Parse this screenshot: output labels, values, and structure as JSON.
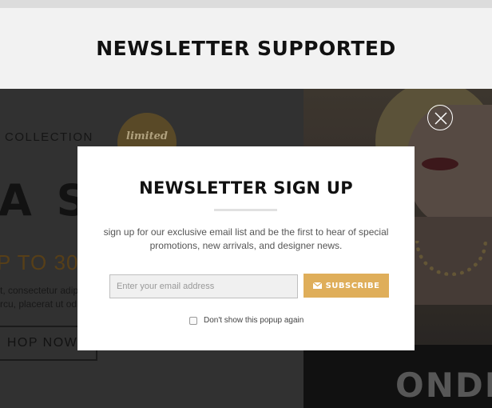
{
  "banner": {
    "title": "NEWSLETTER SUPPORTED"
  },
  "background_page": {
    "collection_text": "COLLECTION",
    "badge_text": "limited",
    "big_headline": "A S",
    "upto_text": "P TO 30",
    "body_line1": "t, consectetur adip",
    "body_line2": "rcu, placerat ut od",
    "shop_button": "HOP NOW!",
    "shirt_text": "ONDI"
  },
  "popup": {
    "title": "NEWSLETTER SIGN UP",
    "description": "sign up for our exclusive email list and be the first to hear of special promotions, new arrivals, and designer news.",
    "email_placeholder": "Enter your email address",
    "email_value": "",
    "subscribe_label": "SUBSCRIBE",
    "subscribe_icon": "envelope-icon",
    "dont_show_label": "Don't show this popup again",
    "dont_show_checked": false,
    "close_icon": "close-icon"
  },
  "colors": {
    "accent": "#dfae5a",
    "overlay": "#3c3c3c",
    "banner_bg": "#f2f2f2"
  }
}
